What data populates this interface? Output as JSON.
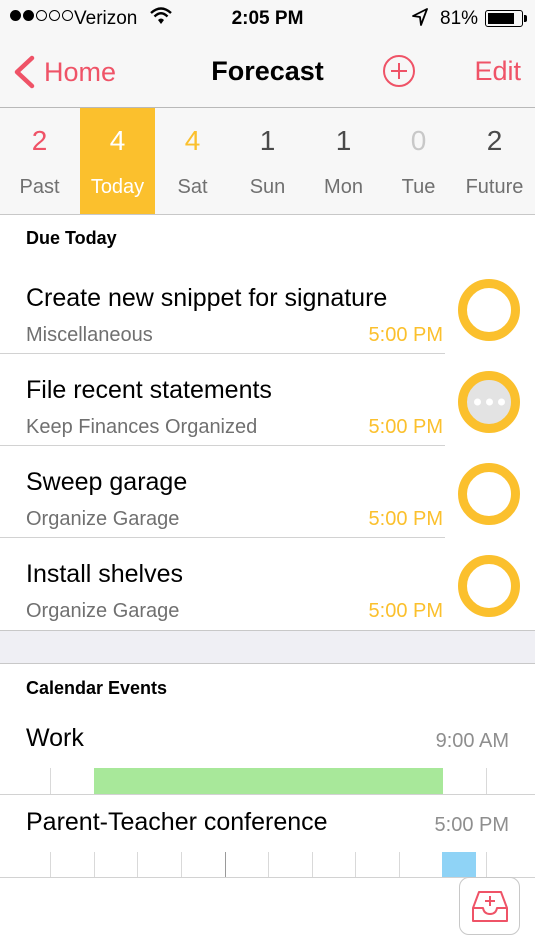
{
  "status_bar": {
    "carrier": "Verizon",
    "time": "2:05 PM",
    "battery": "81%",
    "battery_level": 0.81,
    "signal_bars_filled": 2,
    "signal_bars_total": 5
  },
  "nav": {
    "back_label": "Home",
    "title": "Forecast",
    "edit_label": "Edit"
  },
  "days": [
    {
      "count": "2",
      "label": "Past",
      "color": "#ef5367"
    },
    {
      "count": "4",
      "label": "Today",
      "color": "#ffffff",
      "selected": true
    },
    {
      "count": "4",
      "label": "Sat",
      "color": "#fbc02d"
    },
    {
      "count": "1",
      "label": "Sun",
      "color": "#4a4a4a"
    },
    {
      "count": "1",
      "label": "Mon",
      "color": "#4a4a4a"
    },
    {
      "count": "0",
      "label": "Tue",
      "color": "#c8c8c8"
    },
    {
      "count": "2",
      "label": "Future",
      "color": "#4a4a4a"
    }
  ],
  "due_today": {
    "header": "Due Today",
    "tasks": [
      {
        "title": "Create new snippet for signature",
        "project": "Miscellaneous",
        "due": "5:00 PM",
        "state": "open"
      },
      {
        "title": "File recent statements",
        "project": "Keep Finances Organized",
        "due": "5:00 PM",
        "state": "in-progress"
      },
      {
        "title": "Sweep garage",
        "project": "Organize Garage",
        "due": "5:00 PM",
        "state": "open"
      },
      {
        "title": "Install shelves",
        "project": "Organize Garage",
        "due": "5:00 PM",
        "state": "open"
      }
    ]
  },
  "calendar": {
    "header": "Calendar Events",
    "events": [
      {
        "title": "Work",
        "time": "9:00 AM",
        "color": "#a8e89a"
      },
      {
        "title": "Parent-Teacher conference",
        "time": "5:00 PM",
        "color": "#8fd3f6"
      }
    ]
  },
  "colors": {
    "accent": "#ef5367",
    "due": "#fbc02d"
  },
  "icons": {
    "back": "chevron-left-icon",
    "add": "plus-circle-icon",
    "inbox": "inbox-add-icon"
  }
}
